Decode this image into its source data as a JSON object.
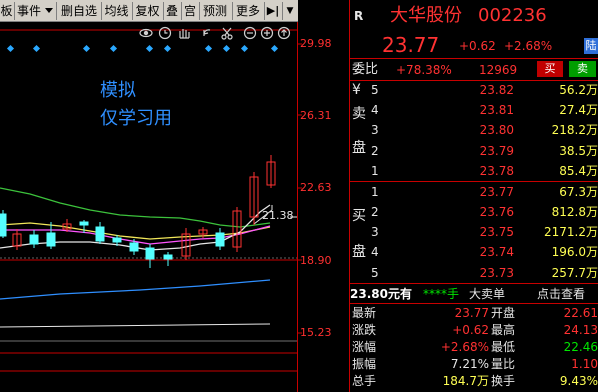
{
  "toolbar": {
    "items": [
      "板",
      "事件",
      "删自选",
      "均线",
      "复权",
      "叠",
      "宫",
      "预测",
      "更多",
      "▶|",
      "▼"
    ]
  },
  "chart": {
    "price_levels": [
      "29.98",
      "26.31",
      "22.63",
      "18.90",
      "15.23"
    ],
    "ma_label": "21.38",
    "watermark_line1": "模拟",
    "watermark_line2": "仅学习用"
  },
  "quote": {
    "badge": "R",
    "stock_name": "大华股份",
    "stock_code": "002236",
    "last_price": "23.77",
    "change": "+0.62",
    "change_pct": "+2.68%",
    "market_tag": "陆",
    "weibi_label": "委比",
    "weibi_value": "+78.38%",
    "weicha_value": "12969",
    "buy_btn": "买",
    "sell_btn": "卖",
    "sell_side": [
      "卖",
      "盘"
    ],
    "buy_side": [
      "买",
      "盘"
    ],
    "asks": [
      {
        "idx": "5",
        "price": "23.82",
        "vol": "56.2万"
      },
      {
        "idx": "4",
        "price": "23.81",
        "vol": "27.4万"
      },
      {
        "idx": "3",
        "price": "23.80",
        "vol": "218.2万"
      },
      {
        "idx": "2",
        "price": "23.79",
        "vol": "38.5万"
      },
      {
        "idx": "1",
        "price": "23.78",
        "vol": "85.4万"
      }
    ],
    "bids": [
      {
        "idx": "1",
        "price": "23.77",
        "vol": "67.3万"
      },
      {
        "idx": "2",
        "price": "23.76",
        "vol": "812.8万"
      },
      {
        "idx": "3",
        "price": "23.75",
        "vol": "2171.2万"
      },
      {
        "idx": "4",
        "price": "23.74",
        "vol": "196.0万"
      },
      {
        "idx": "5",
        "price": "23.73",
        "vol": "257.7万"
      }
    ],
    "info_price": "23.80元有",
    "info_stars": "****手",
    "info_big": "大卖单",
    "info_link": "点击查看",
    "stats": [
      {
        "l1": "最新",
        "v1": "23.77",
        "l2": "开盘",
        "v2": "22.61",
        "c1": "red",
        "c2": "red"
      },
      {
        "l1": "涨跌",
        "v1": "+0.62",
        "l2": "最高",
        "v2": "24.13",
        "c1": "red",
        "c2": "red"
      },
      {
        "l1": "涨幅",
        "v1": "+2.68%",
        "l2": "最低",
        "v2": "22.46",
        "c1": "red",
        "c2": "grn"
      },
      {
        "l1": "振幅",
        "v1": "7.21%",
        "l2": "量比",
        "v2": "1.10",
        "c1": "wht",
        "c2": "red"
      },
      {
        "l1": "总手",
        "v1": "184.7万",
        "l2": "换手",
        "v2": "9.43%",
        "c1": "yel",
        "c2": "yel"
      }
    ]
  }
}
